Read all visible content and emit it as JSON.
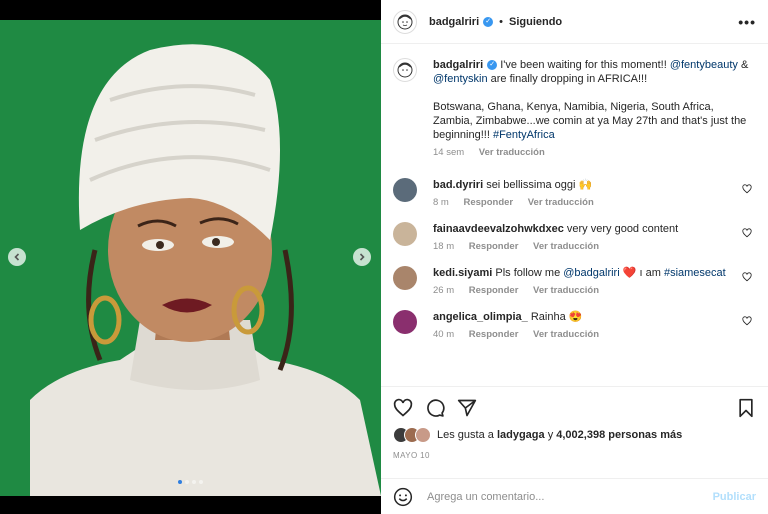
{
  "post": {
    "username": "badgalriri",
    "follow_label": "Siguiendo",
    "more_label": "•••"
  },
  "caption": {
    "username": "badgalriri",
    "text_1": "I've been waiting for this moment!!",
    "mention_1": "@fentybeauty",
    "text_2": "&",
    "mention_2": "@fentyskin",
    "text_3": "are finally dropping in AFRICA!!!",
    "paragraph_2": "Botswana, Ghana, Kenya, Namibia, Nigeria, South Africa, Zambia, Zimbabwe...we comin at ya May 27th and that's just the beginning!!!",
    "hashtag": "#FentyAfrica",
    "time": "14 sem",
    "translate_label": "Ver traducción"
  },
  "comments": [
    {
      "username": "bad.dyriri",
      "text": "sei bellissima oggi 🙌",
      "time": "8 m",
      "reply": "Responder",
      "translate": "Ver traducción"
    },
    {
      "username": "fainaavdeevalzohwkdxec",
      "text": "very very good content",
      "time": "18 m",
      "reply": "Responder",
      "translate": "Ver traducción"
    },
    {
      "username": "kedi.siyami",
      "text_a": "Pls follow me",
      "mention": "@badgalriri",
      "text_b": "❤️ ı am",
      "hashtag": "#siamesecat",
      "time": "26 m",
      "reply": "Responder",
      "translate": "Ver traducción"
    },
    {
      "username": "angelica_olimpia_",
      "text": "Rainha 😍",
      "time": "40 m",
      "reply": "Responder",
      "translate": "Ver traducción"
    }
  ],
  "likes": {
    "prefix": "Les gusta a",
    "user": "ladygaga",
    "joiner": "y",
    "count": "4,002,398 personas más"
  },
  "date": "MAYO 10",
  "add_comment": {
    "placeholder": "Agrega un comentario...",
    "publish_label": "Publicar"
  },
  "colors": {
    "photo_background": "#1f8a43",
    "link": "#00376b",
    "verified": "#3897f0",
    "publish_disabled": "#b2dffc",
    "heart_emoji": "#e0245e"
  }
}
